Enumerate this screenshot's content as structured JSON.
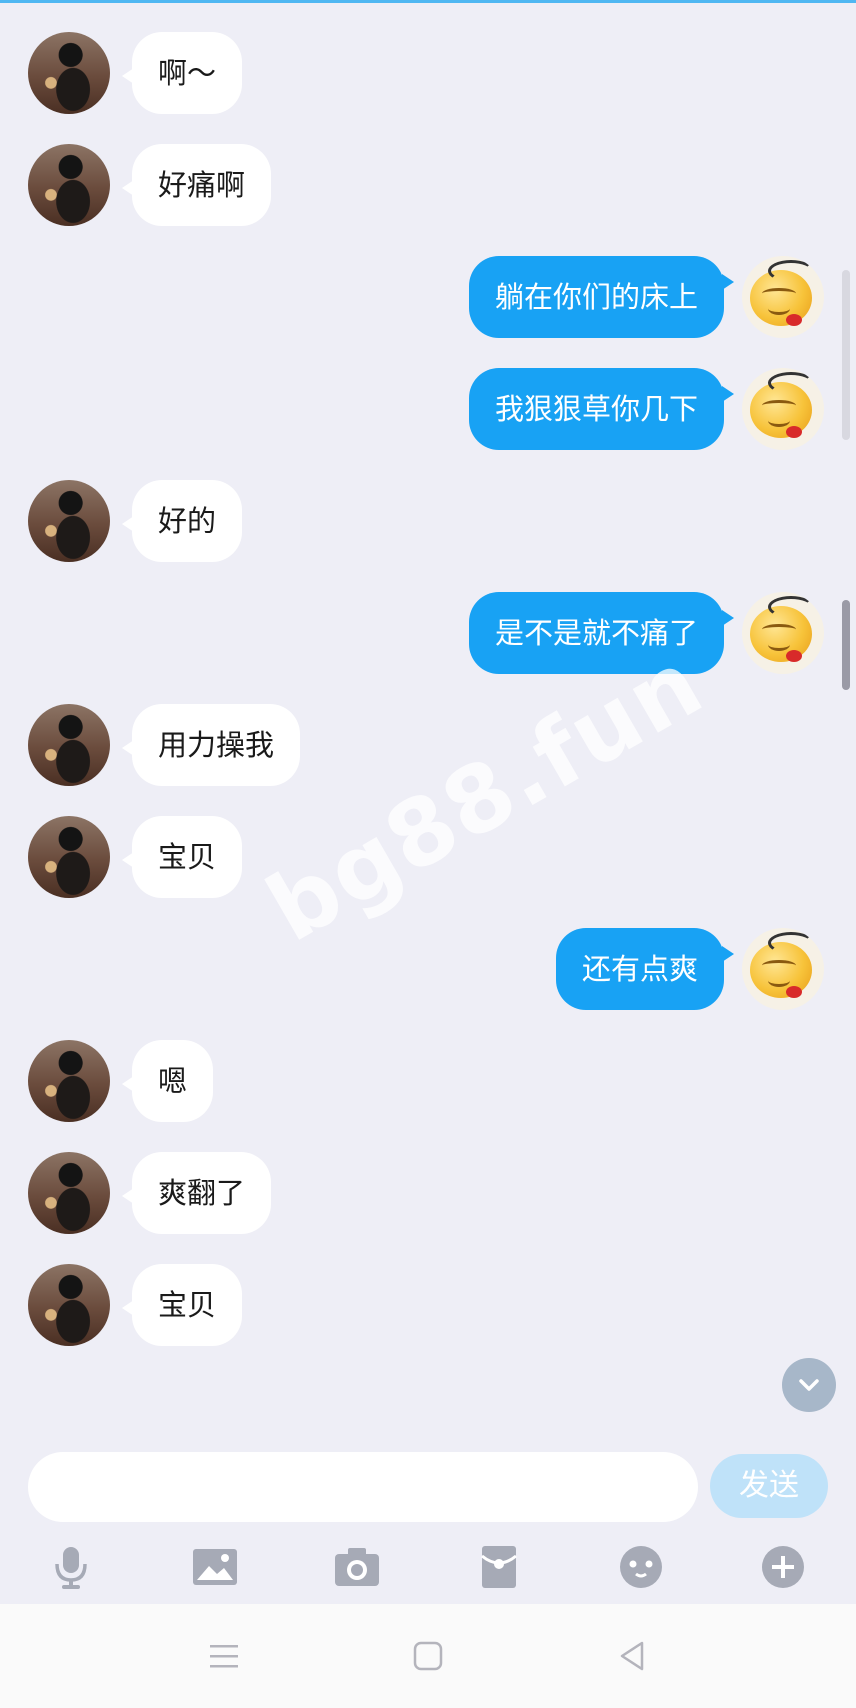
{
  "messages": [
    {
      "side": "in",
      "text": "啊～"
    },
    {
      "side": "in",
      "text": "好痛啊"
    },
    {
      "side": "out",
      "text": "躺在你们的床上"
    },
    {
      "side": "out",
      "text": "我狠狠草你几下"
    },
    {
      "side": "in",
      "text": "好的"
    },
    {
      "side": "out",
      "text": "是不是就不痛了"
    },
    {
      "side": "in",
      "text": "用力操我"
    },
    {
      "side": "in",
      "text": "宝贝"
    },
    {
      "side": "out",
      "text": "还有点爽"
    },
    {
      "side": "in",
      "text": "嗯"
    },
    {
      "side": "in",
      "text": "爽翻了"
    },
    {
      "side": "in",
      "text": "宝贝"
    }
  ],
  "watermark": "bg88.fun",
  "input": {
    "value": "",
    "placeholder": ""
  },
  "send_label": "发送",
  "toolbar": [
    "microphone-icon",
    "image-icon",
    "camera-icon",
    "red-packet-icon",
    "emoji-icon",
    "plus-icon"
  ],
  "navbar": [
    "menu-icon",
    "home-icon",
    "back-icon"
  ],
  "colors": {
    "accent": "#18a2f4",
    "background": "#eeeef6",
    "send_disabled": "#bfe2f9"
  }
}
